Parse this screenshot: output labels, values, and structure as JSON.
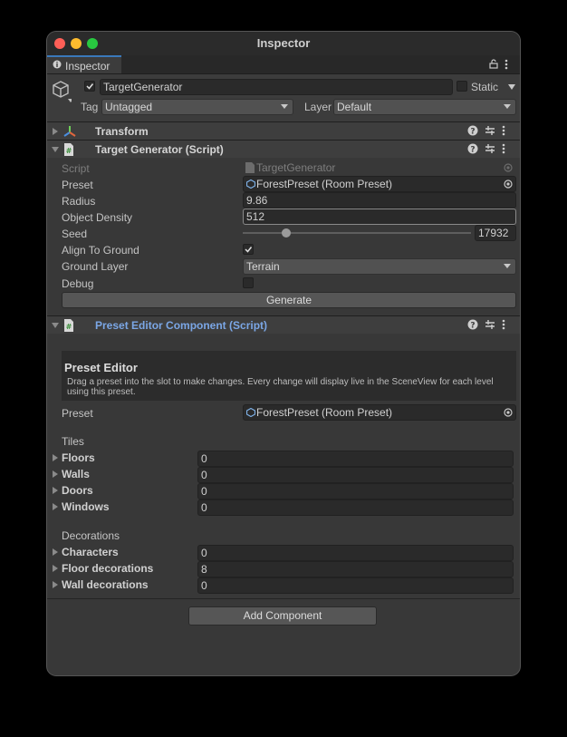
{
  "window": {
    "title": "Inspector",
    "traffic_lights": {
      "close": "#fe5f57",
      "minimize": "#febc2e",
      "zoom": "#28c840"
    }
  },
  "tab": {
    "label": "Inspector",
    "icon": "info-icon"
  },
  "gameobject": {
    "active": true,
    "name": "TargetGenerator",
    "static_label": "Static",
    "static": false,
    "tag_label": "Tag",
    "tag_value": "Untagged",
    "layer_label": "Layer",
    "layer_value": "Default"
  },
  "transform": {
    "title": "Transform",
    "expanded": false
  },
  "target_generator": {
    "title": "Target Generator (Script)",
    "expanded": true,
    "fields": {
      "script_label": "Script",
      "script_value": "TargetGenerator",
      "preset_label": "Preset",
      "preset_value": "ForestPreset (Room Preset)",
      "radius_label": "Radius",
      "radius_value": "9.86",
      "density_label": "Object Density",
      "density_value": "512",
      "seed_label": "Seed",
      "seed_value": "17932",
      "seed_slider_fraction": 0.19,
      "align_label": "Align To Ground",
      "align_value": true,
      "ground_label": "Ground Layer",
      "ground_value": "Terrain",
      "debug_label": "Debug",
      "debug_value": false
    },
    "generate_button": "Generate"
  },
  "preset_editor": {
    "title": "Preset Editor Component (Script)",
    "expanded": true,
    "box_title": "Preset Editor",
    "box_text_line1": "Drag a preset into the slot to make changes. Every change will display live in the SceneView for each level",
    "box_text_line2": "using this preset.",
    "preset_label": "Preset",
    "preset_value": "ForestPreset (Room Preset)",
    "tiles_header": "Tiles",
    "tiles": [
      {
        "label": "Floors",
        "value": "0"
      },
      {
        "label": "Walls",
        "value": "0"
      },
      {
        "label": "Doors",
        "value": "0"
      },
      {
        "label": "Windows",
        "value": "0"
      }
    ],
    "decorations_header": "Decorations",
    "decorations": [
      {
        "label": "Characters",
        "value": "0"
      },
      {
        "label": "Floor decorations",
        "value": "8"
      },
      {
        "label": "Wall decorations",
        "value": "0"
      }
    ]
  },
  "add_component_button": "Add Component"
}
